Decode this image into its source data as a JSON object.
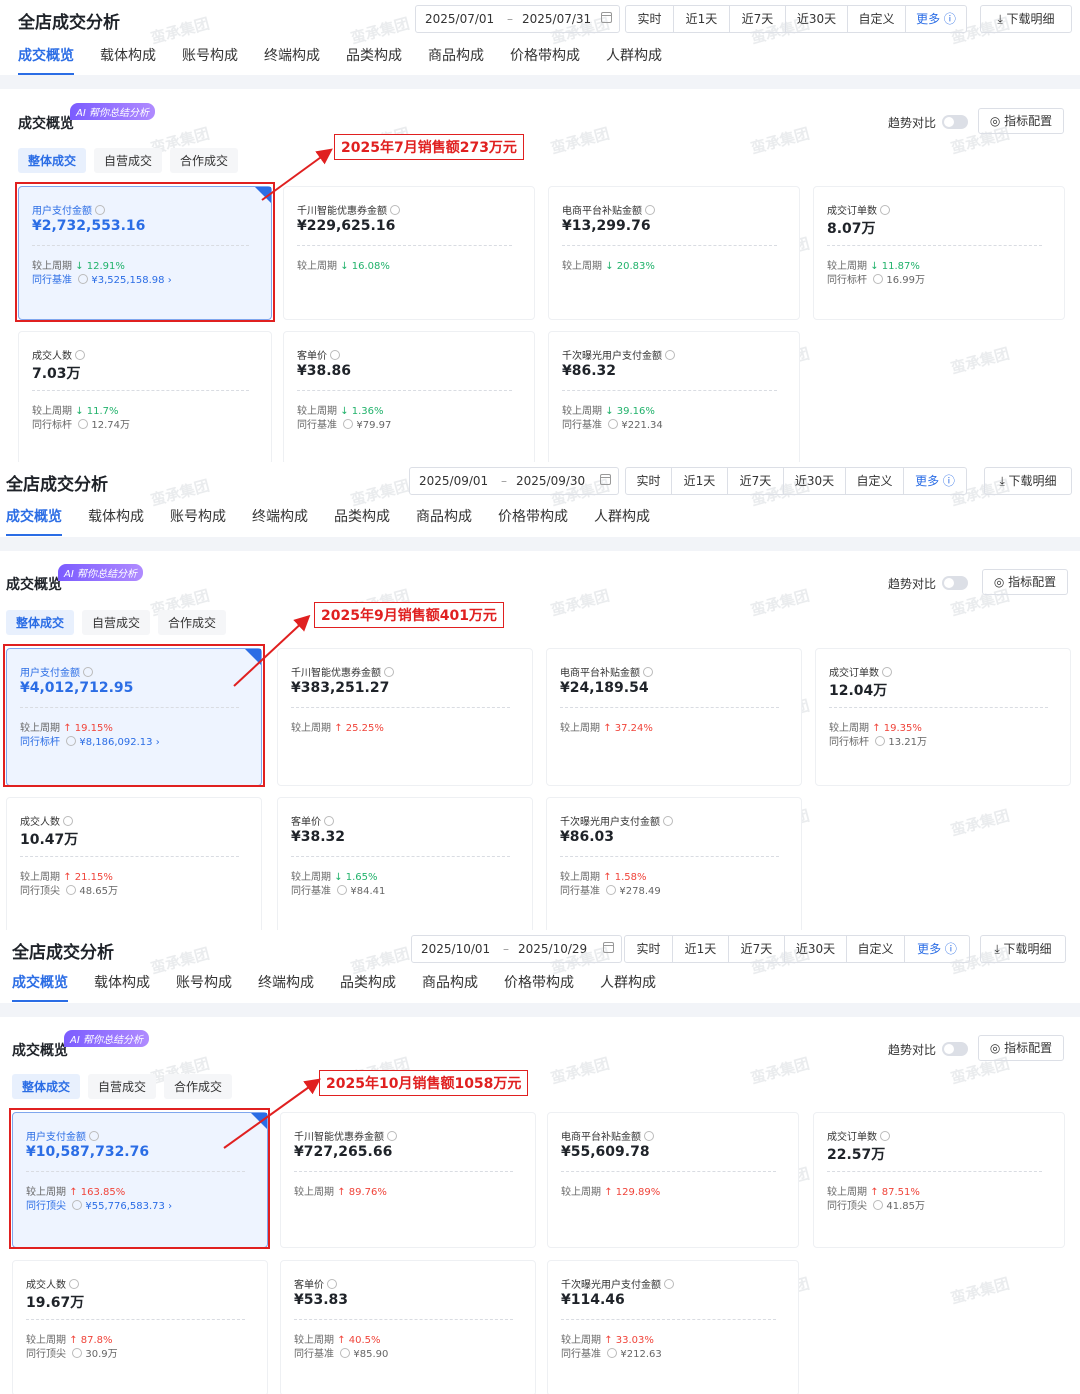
{
  "common": {
    "page_title": "全店成交分析",
    "date_sep": "–",
    "range_options": [
      "实时",
      "近1天",
      "近7天",
      "近30天",
      "自定义",
      "更多 ⓘ"
    ],
    "download_label": "⤓ 下载明细",
    "tabs": [
      "成交概览",
      "载体构成",
      "账号构成",
      "终端构成",
      "品类构成",
      "商品构成",
      "价格带构成",
      "人群构成"
    ],
    "section_title": "成交概览",
    "ai_badge": "AI 帮你总结分析",
    "trend_label": "趋势对比",
    "config_label": "◎ 指标配置",
    "subtabs": [
      "整体成交",
      "自营成交",
      "合作成交"
    ],
    "watermark": "蛮承集团"
  },
  "panels": [
    {
      "start_date": "2025/07/01",
      "end_date": "2025/07/31",
      "callout": "2025年7月销售额273万元",
      "cards": [
        {
          "label": "用户支付金额",
          "value": "¥2,732,553.16",
          "r1_label": "较上周期",
          "r1_dir": "down",
          "r1_value": "↓ 12.91%",
          "r2_label": "同行基准",
          "r2_value": "¥3,525,158.98 ›"
        },
        {
          "label": "千川智能优惠券金额",
          "value": "¥229,625.16",
          "r1_label": "较上周期",
          "r1_dir": "down",
          "r1_value": "↓ 16.08%",
          "r2_label": "",
          "r2_value": ""
        },
        {
          "label": "电商平台补贴金额",
          "value": "¥13,299.76",
          "r1_label": "较上周期",
          "r1_dir": "down",
          "r1_value": "↓ 20.83%",
          "r2_label": "",
          "r2_value": ""
        },
        {
          "label": "成交订单数",
          "value": "8.07万",
          "r1_label": "较上周期",
          "r1_dir": "down",
          "r1_value": "↓ 11.87%",
          "r2_label": "同行标杆",
          "r2_value": "16.99万"
        },
        {
          "label": "成交人数",
          "value": "7.03万",
          "r1_label": "较上周期",
          "r1_dir": "down",
          "r1_value": "↓ 11.7%",
          "r2_label": "同行标杆",
          "r2_value": "12.74万"
        },
        {
          "label": "客单价",
          "value": "¥38.86",
          "r1_label": "较上周期",
          "r1_dir": "down",
          "r1_value": "↓ 1.36%",
          "r2_label": "同行基准",
          "r2_value": "¥79.97"
        },
        {
          "label": "千次曝光用户支付金额",
          "value": "¥86.32",
          "r1_label": "较上周期",
          "r1_dir": "down",
          "r1_value": "↓ 39.16%",
          "r2_label": "同行基准",
          "r2_value": "¥221.34"
        }
      ]
    },
    {
      "start_date": "2025/09/01",
      "end_date": "2025/09/30",
      "callout": "2025年9月销售额401万元",
      "cards": [
        {
          "label": "用户支付金额",
          "value": "¥4,012,712.95",
          "r1_label": "较上周期",
          "r1_dir": "up",
          "r1_value": "↑ 19.15%",
          "r2_label": "同行标杆",
          "r2_value": "¥8,186,092.13 ›"
        },
        {
          "label": "千川智能优惠券金额",
          "value": "¥383,251.27",
          "r1_label": "较上周期",
          "r1_dir": "up",
          "r1_value": "↑ 25.25%",
          "r2_label": "",
          "r2_value": ""
        },
        {
          "label": "电商平台补贴金额",
          "value": "¥24,189.54",
          "r1_label": "较上周期",
          "r1_dir": "up",
          "r1_value": "↑ 37.24%",
          "r2_label": "",
          "r2_value": ""
        },
        {
          "label": "成交订单数",
          "value": "12.04万",
          "r1_label": "较上周期",
          "r1_dir": "up",
          "r1_value": "↑ 19.35%",
          "r2_label": "同行标杆",
          "r2_value": "13.21万"
        },
        {
          "label": "成交人数",
          "value": "10.47万",
          "r1_label": "较上周期",
          "r1_dir": "up",
          "r1_value": "↑ 21.15%",
          "r2_label": "同行顶尖",
          "r2_value": "48.65万"
        },
        {
          "label": "客单价",
          "value": "¥38.32",
          "r1_label": "较上周期",
          "r1_dir": "down",
          "r1_value": "↓ 1.65%",
          "r2_label": "同行基准",
          "r2_value": "¥84.41"
        },
        {
          "label": "千次曝光用户支付金额",
          "value": "¥86.03",
          "r1_label": "较上周期",
          "r1_dir": "up",
          "r1_value": "↑ 1.58%",
          "r2_label": "同行基准",
          "r2_value": "¥278.49"
        }
      ]
    },
    {
      "start_date": "2025/10/01",
      "end_date": "2025/10/29",
      "callout": "2025年10月销售额1058万元",
      "cards": [
        {
          "label": "用户支付金额",
          "value": "¥10,587,732.76",
          "r1_label": "较上周期",
          "r1_dir": "up",
          "r1_value": "↑ 163.85%",
          "r2_label": "同行顶尖",
          "r2_value": "¥55,776,583.73 ›"
        },
        {
          "label": "千川智能优惠券金额",
          "value": "¥727,265.66",
          "r1_label": "较上周期",
          "r1_dir": "up",
          "r1_value": "↑ 89.76%",
          "r2_label": "",
          "r2_value": ""
        },
        {
          "label": "电商平台补贴金额",
          "value": "¥55,609.78",
          "r1_label": "较上周期",
          "r1_dir": "up",
          "r1_value": "↑ 129.89%",
          "r2_label": "",
          "r2_value": ""
        },
        {
          "label": "成交订单数",
          "value": "22.57万",
          "r1_label": "较上周期",
          "r1_dir": "up",
          "r1_value": "↑ 87.51%",
          "r2_label": "同行顶尖",
          "r2_value": "41.85万"
        },
        {
          "label": "成交人数",
          "value": "19.67万",
          "r1_label": "较上周期",
          "r1_dir": "up",
          "r1_value": "↑ 87.8%",
          "r2_label": "同行顶尖",
          "r2_value": "30.9万"
        },
        {
          "label": "客单价",
          "value": "¥53.83",
          "r1_label": "较上周期",
          "r1_dir": "up",
          "r1_value": "↑ 40.5%",
          "r2_label": "同行基准",
          "r2_value": "¥85.90"
        },
        {
          "label": "千次曝光用户支付金额",
          "value": "¥114.46",
          "r1_label": "较上周期",
          "r1_dir": "up",
          "r1_value": "↑ 33.03%",
          "r2_label": "同行基准",
          "r2_value": "¥212.63"
        }
      ]
    }
  ]
}
